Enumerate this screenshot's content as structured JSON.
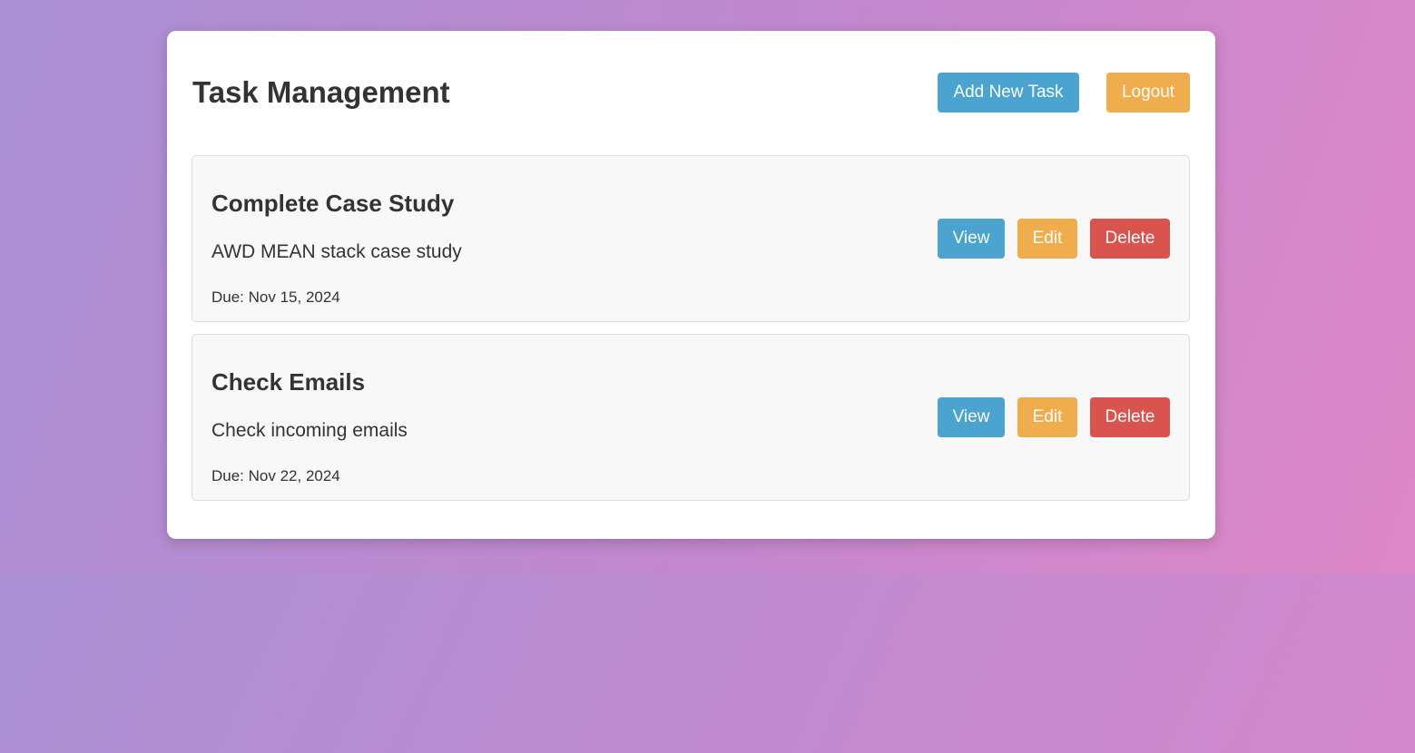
{
  "header": {
    "title": "Task Management",
    "add_label": "Add New Task",
    "logout_label": "Logout"
  },
  "tasks": [
    {
      "title": "Complete Case Study",
      "description": "AWD MEAN stack case study",
      "due": "Due: Nov 15, 2024",
      "view_label": "View",
      "edit_label": "Edit",
      "delete_label": "Delete"
    },
    {
      "title": "Check Emails",
      "description": "Check incoming emails",
      "due": "Due: Nov 22, 2024",
      "view_label": "View",
      "edit_label": "Edit",
      "delete_label": "Delete"
    }
  ],
  "colors": {
    "primary": "#4ba3d0",
    "warning": "#f0ad4e",
    "danger": "#d9534f",
    "text": "#333333",
    "card_bg": "#ffffff",
    "task_bg": "#f8f8f8"
  }
}
